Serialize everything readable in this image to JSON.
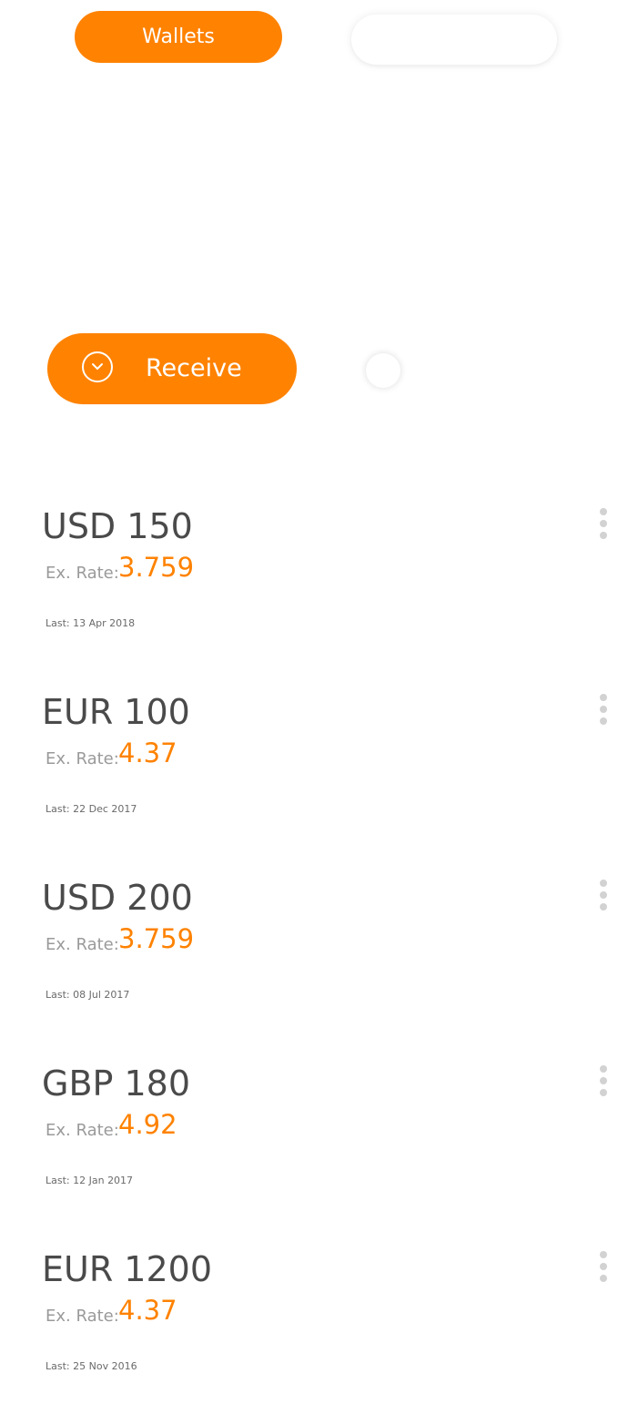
{
  "tabs": {
    "wallets_label": "Wallets",
    "other_label": ""
  },
  "actions": {
    "receive_label": "Receive"
  },
  "colors": {
    "accent": "#ff8200",
    "text_primary": "#4a4a4a",
    "text_muted": "#9a9a9a",
    "menu_dots": "#d2d2d2"
  },
  "icons": {
    "receive": "chevron-down-circle-icon",
    "more": "more-vertical-icon"
  },
  "wallets": [
    {
      "amount": "USD 150",
      "rate_label": "Ex. Rate:",
      "rate_value": "3.759",
      "last": "Last: 13 Apr 2018"
    },
    {
      "amount": "EUR 100",
      "rate_label": "Ex. Rate:",
      "rate_value": "4.37",
      "last": "Last: 22 Dec 2017"
    },
    {
      "amount": "USD 200",
      "rate_label": "Ex. Rate:",
      "rate_value": "3.759",
      "last": "Last: 08 Jul 2017"
    },
    {
      "amount": "GBP 180",
      "rate_label": "Ex. Rate:",
      "rate_value": "4.92",
      "last": "Last: 12 Jan 2017"
    },
    {
      "amount": "EUR 1200",
      "rate_label": "Ex. Rate:",
      "rate_value": "4.37",
      "last": "Last: 25  Nov 2016"
    }
  ]
}
